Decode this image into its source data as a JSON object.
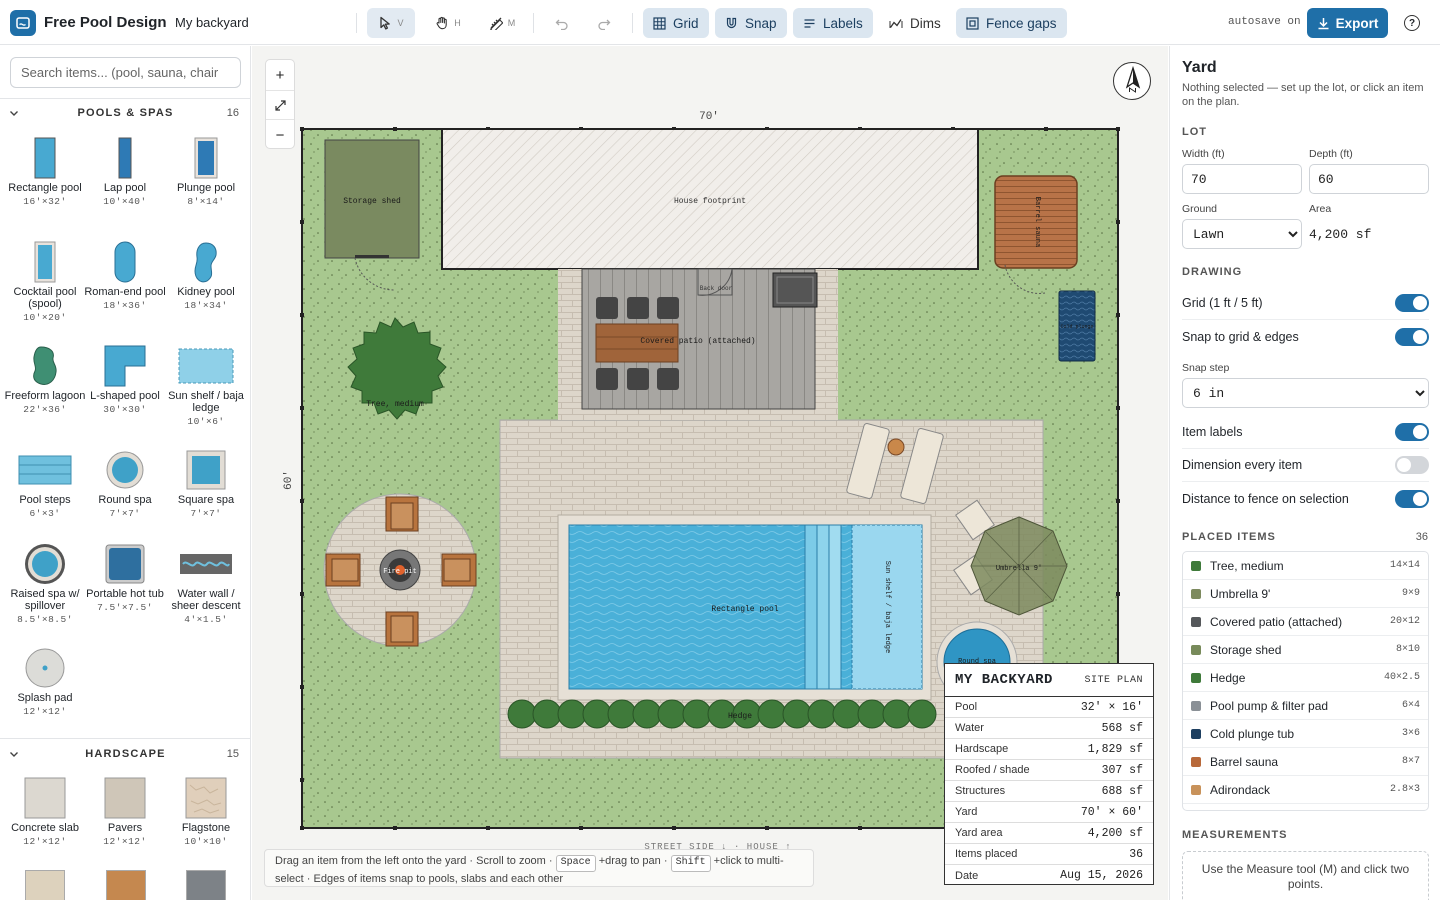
{
  "app": {
    "title": "Free Pool Design",
    "project": "My backyard",
    "autosave": "autosave on",
    "export_label": "Export",
    "help": "?"
  },
  "toolbar": {
    "select": {
      "key": "V"
    },
    "pan": {
      "key": "H"
    },
    "measure": {
      "key": "M"
    },
    "grid": "Grid",
    "snap": "Snap",
    "labels": "Labels",
    "dims": "Dims",
    "fence_gaps": "Fence gaps"
  },
  "search": {
    "placeholder": "Search items... (pool, sauna, chair"
  },
  "sections": {
    "pools": {
      "title": "POOLS & SPAS",
      "count": "16",
      "items": [
        {
          "name": "Rectangle pool",
          "dims": "16'×32'"
        },
        {
          "name": "Lap pool",
          "dims": "10'×40'"
        },
        {
          "name": "Plunge pool",
          "dims": "8'×14'"
        },
        {
          "name": "Cocktail pool (spool)",
          "dims": "10'×20'"
        },
        {
          "name": "Roman-end pool",
          "dims": "18'×36'"
        },
        {
          "name": "Kidney pool",
          "dims": "18'×34'"
        },
        {
          "name": "Freeform lagoon",
          "dims": "22'×36'"
        },
        {
          "name": "L-shaped pool",
          "dims": "30'×30'"
        },
        {
          "name": "Sun shelf / baja ledge",
          "dims": "10'×6'"
        },
        {
          "name": "Pool steps",
          "dims": "6'×3'"
        },
        {
          "name": "Round spa",
          "dims": "7'×7'"
        },
        {
          "name": "Square spa",
          "dims": "7'×7'"
        },
        {
          "name": "Raised spa w/ spillover",
          "dims": "8.5'×8.5'"
        },
        {
          "name": "Portable hot tub",
          "dims": "7.5'×7.5'"
        },
        {
          "name": "Water wall / sheer descent",
          "dims": "4'×1.5'"
        },
        {
          "name": "Splash pad",
          "dims": "12'×12'"
        }
      ]
    },
    "hardscape": {
      "title": "HARDSCAPE",
      "count": "15",
      "items": [
        {
          "name": "Concrete slab",
          "dims": "12'×12'"
        },
        {
          "name": "Pavers",
          "dims": "12'×12'"
        },
        {
          "name": "Flagstone",
          "dims": "10'×10'"
        }
      ]
    }
  },
  "plan": {
    "width_label": "70'",
    "depth_label": "60'",
    "labels": {
      "storage_shed": "Storage shed",
      "house": "House footprint",
      "back_door": "Back door",
      "patio": "Covered patio (attached)",
      "barrel_sauna": "Barrel sauna",
      "cold_plunge": "Cold plunge",
      "tree": "Tree, medium",
      "fire_pit": "Fire pit",
      "pool": "Rectangle pool",
      "sun_shelf": "Sun shelf / baja ledge",
      "umbrella": "Umbrella 9'",
      "round_spa": "Round spa",
      "hedge": "Hedge"
    },
    "street": "STREET SIDE ↓ · HOUSE ↑"
  },
  "hint": {
    "t1": "Drag an item from the left onto the yard · Scroll to zoom ·",
    "k1": "Space",
    "t2": "+drag to pan ·",
    "k2": "Shift",
    "t3": "+click to multi-select · Edges of items snap to pools, slabs and each other"
  },
  "legend": {
    "title": "MY BACKYARD",
    "subtitle": "SITE PLAN",
    "rows": [
      {
        "label": "Pool",
        "value": "32' × 16'"
      },
      {
        "label": "Water",
        "value": "568 sf"
      },
      {
        "label": "Hardscape",
        "value": "1,829 sf"
      },
      {
        "label": "Roofed / shade",
        "value": "307 sf"
      },
      {
        "label": "Structures",
        "value": "688 sf"
      },
      {
        "label": "Yard",
        "value": "70' × 60'"
      },
      {
        "label": "Yard area",
        "value": "4,200 sf"
      },
      {
        "label": "Items placed",
        "value": "36"
      },
      {
        "label": "Date",
        "value": "Aug 15, 2026"
      }
    ]
  },
  "panel": {
    "title": "Yard",
    "subtitle": "Nothing selected — set up the lot, or click an item on the plan.",
    "lot": {
      "heading": "LOT",
      "width_label": "Width (ft)",
      "width": "70",
      "depth_label": "Depth (ft)",
      "depth": "60",
      "ground_label": "Ground",
      "ground": "Lawn",
      "area_label": "Area",
      "area": "4,200 sf"
    },
    "drawing": {
      "heading": "DRAWING",
      "grid": "Grid (1 ft / 5 ft)",
      "snap": "Snap to grid & edges",
      "snap_step_label": "Snap step",
      "snap_step": "6 in",
      "labels": "Item labels",
      "dims": "Dimension every item",
      "fence": "Distance to fence on selection"
    },
    "placed": {
      "heading": "PLACED ITEMS",
      "count": "36",
      "items": [
        {
          "name": "Tree, medium",
          "dims": "14×14",
          "color": "#3f7a3a"
        },
        {
          "name": "Umbrella 9'",
          "dims": "9×9",
          "color": "#7d8a5e"
        },
        {
          "name": "Covered patio (attached)",
          "dims": "20×12",
          "color": "#55585b"
        },
        {
          "name": "Storage shed",
          "dims": "8×10",
          "color": "#788a5a"
        },
        {
          "name": "Hedge",
          "dims": "40×2.5",
          "color": "#3f7a3a"
        },
        {
          "name": "Pool pump & filter pad",
          "dims": "6×4",
          "color": "#8a9096"
        },
        {
          "name": "Cold plunge tub",
          "dims": "3×6",
          "color": "#1d3f60"
        },
        {
          "name": "Barrel sauna",
          "dims": "8×7",
          "color": "#b8693a"
        },
        {
          "name": "Adirondack",
          "dims": "2.8×3",
          "color": "#c8925a"
        }
      ]
    },
    "measurements": {
      "heading": "MEASUREMENTS",
      "text": "Use the Measure tool (M) and click two points."
    }
  }
}
